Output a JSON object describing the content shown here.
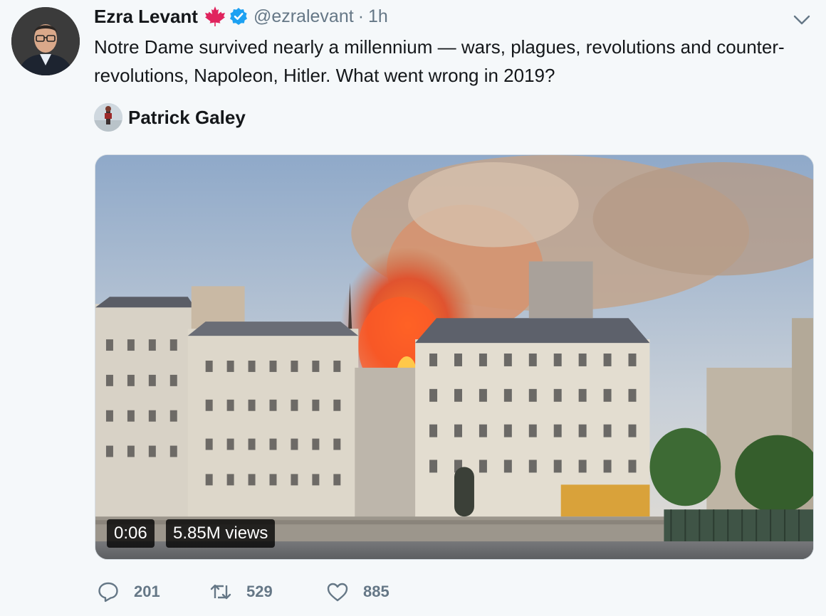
{
  "author": {
    "name": "Ezra Levant",
    "handle": "@ezralevant",
    "separator": "·",
    "time": "1h",
    "badge_icon": "maple-leaf-icon",
    "verified_icon": "verified-badge-icon"
  },
  "tweet": {
    "text": "Notre Dame survived nearly a millennium — wars, plagues, revolutions and counter-revolutions, Napoleon, Hitler. What went wrong in 2019?"
  },
  "attribution": {
    "name": "Patrick Galey"
  },
  "media": {
    "duration": "0:06",
    "views": "5.85M views"
  },
  "actions": {
    "reply_count": "201",
    "retweet_count": "529",
    "like_count": "885"
  },
  "colors": {
    "background": "#f5f8fa",
    "text_primary": "#14171a",
    "text_secondary": "#657786",
    "verified_blue": "#1da1f2",
    "maple_red": "#e0245e"
  }
}
